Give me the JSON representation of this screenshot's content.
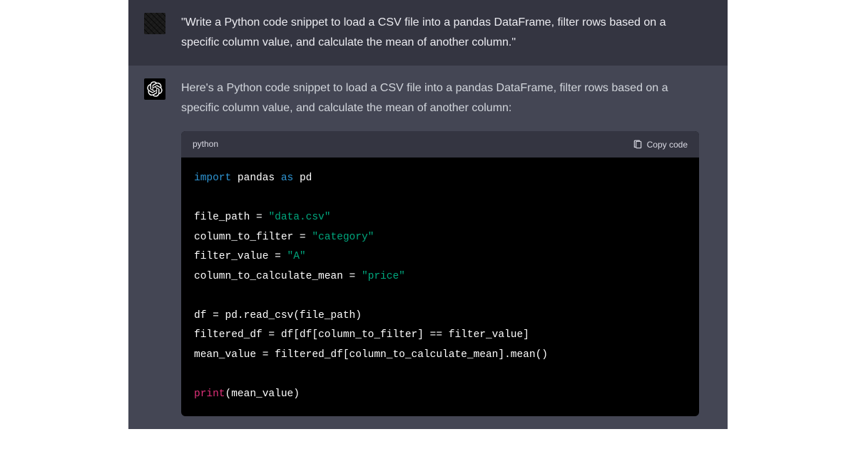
{
  "user": {
    "message": "\"Write a Python code snippet to load a CSV file into a pandas DataFrame, filter rows based on a specific column value, and calculate the mean of another column.\""
  },
  "assistant": {
    "intro": "Here's a Python code snippet to load a CSV file into a pandas DataFrame, filter rows based on a specific column value, and calculate the mean of another column:",
    "code": {
      "language": "python",
      "copy_label": "Copy code",
      "tokens": {
        "import": "import",
        "pandas": "pandas",
        "as": "as",
        "pd": "pd",
        "file_path": "file_path",
        "eq": " = ",
        "data_csv": "\"data.csv\"",
        "column_to_filter": "column_to_filter",
        "category": "\"category\"",
        "filter_value": "filter_value",
        "a": "\"A\"",
        "column_to_calculate_mean": "column_to_calculate_mean",
        "price": "\"price\"",
        "df": "df",
        "read_csv_call": " = pd.read_csv(file_path)",
        "filtered_df": "filtered_df",
        "filter_expr": " = df[df[column_to_filter] == filter_value]",
        "mean_value": "mean_value",
        "mean_expr": " = filtered_df[column_to_calculate_mean].mean()",
        "print": "print",
        "print_args": "(mean_value)"
      }
    }
  }
}
